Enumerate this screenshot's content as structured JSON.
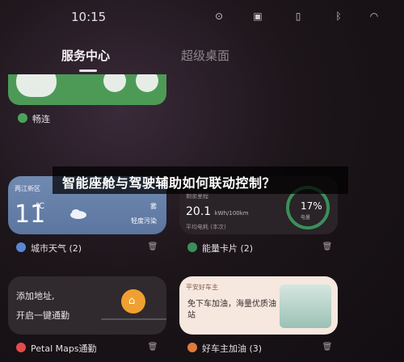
{
  "status": {
    "time": "10:15",
    "icons": [
      "hotspot-icon",
      "cast-icon",
      "vibrate-icon",
      "bluetooth-icon",
      "wifi-icon"
    ]
  },
  "tabs": [
    {
      "label": "服务中心",
      "active": true
    },
    {
      "label": "超级桌面",
      "active": false
    }
  ],
  "cards": {
    "changlian": {
      "label": "畅连"
    },
    "weather": {
      "location": "两江新区",
      "temp": "11",
      "unit": "℃",
      "condition": "雾",
      "air": "轻度污染",
      "label": "城市天气 (2)"
    },
    "energy": {
      "title": "剩余里程",
      "value": "20.1",
      "unit": "kWh/100km",
      "subtitle": "平均电耗 (本次)",
      "percent": "17%",
      "percent_label": "电量",
      "label": "能量卡片 (2)"
    },
    "map": {
      "line1": "添加地址,",
      "line2": "开启一键通勤",
      "label": "Petal Maps通勤"
    },
    "car": {
      "header": "平安好车主",
      "body": "免下车加油，海量优质油站",
      "label": "好车主加油 (3)"
    }
  },
  "banner": {
    "text": "智能座舱与驾驶辅助如何联动控制？"
  },
  "colors": {
    "accent": "#3b8f5a",
    "weather_bg": "#6a82ab",
    "car_bg": "#f6e8df"
  }
}
